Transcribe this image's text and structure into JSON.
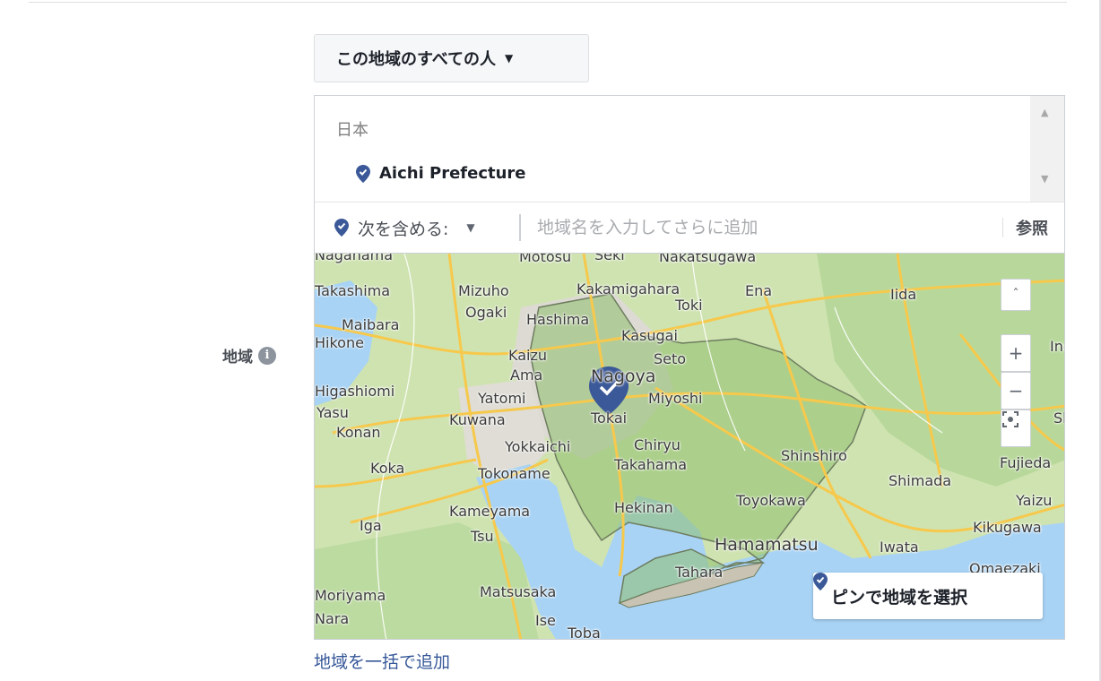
{
  "audience_dropdown": {
    "label": "この地域のすべての人"
  },
  "field_label": "地域",
  "info_icon": "i",
  "selected": {
    "country": "日本",
    "locations": [
      {
        "name": "Aichi Prefecture"
      }
    ]
  },
  "include": {
    "label": "次を含める:",
    "placeholder": "地域名を入力してさらに追加",
    "browse": "参照"
  },
  "map": {
    "places": [
      {
        "name": "Nagahama"
      },
      {
        "name": "Motosu"
      },
      {
        "name": "Seki"
      },
      {
        "name": "Nakatsugawa"
      },
      {
        "name": "Takashima"
      },
      {
        "name": "Mizuho"
      },
      {
        "name": "Kakamigahara"
      },
      {
        "name": "Ena"
      },
      {
        "name": "Iida"
      },
      {
        "name": "Toki"
      },
      {
        "name": "Ogaki"
      },
      {
        "name": "Hashima"
      },
      {
        "name": "Maibara"
      },
      {
        "name": "Hikone"
      },
      {
        "name": "Kasugai"
      },
      {
        "name": "Kaizu"
      },
      {
        "name": "Seto"
      },
      {
        "name": "Ama"
      },
      {
        "name": "Nagoya"
      },
      {
        "name": "Higashiomi"
      },
      {
        "name": "Yatomi"
      },
      {
        "name": "Miyoshi"
      },
      {
        "name": "Yasu"
      },
      {
        "name": "Kuwana"
      },
      {
        "name": "Tokai"
      },
      {
        "name": "Konan"
      },
      {
        "name": "Yokkaichi"
      },
      {
        "name": "Chiryu"
      },
      {
        "name": "Koka"
      },
      {
        "name": "Tokoname"
      },
      {
        "name": "Takahama"
      },
      {
        "name": "Shinshiro"
      },
      {
        "name": "Fujieda"
      },
      {
        "name": "Shimada"
      },
      {
        "name": "Toyokawa"
      },
      {
        "name": "Yaizu"
      },
      {
        "name": "Kameyama"
      },
      {
        "name": "Hekinan"
      },
      {
        "name": "Iga"
      },
      {
        "name": "Tsu"
      },
      {
        "name": "Kikugawa"
      },
      {
        "name": "Hamamatsu"
      },
      {
        "name": "Iwata"
      },
      {
        "name": "Tahara"
      },
      {
        "name": "Omaezaki"
      },
      {
        "name": "Matsusaka"
      },
      {
        "name": "Moriyama"
      },
      {
        "name": "Ise"
      },
      {
        "name": "Toba"
      },
      {
        "name": "Nara"
      },
      {
        "name": "Shizuoka"
      },
      {
        "name": "Ino"
      }
    ],
    "controls": {
      "collapse": "ˆ",
      "zoom_in": "+",
      "zoom_out": "−"
    },
    "pin_select_label": "ピンで地域を選択"
  },
  "bulk_add_link": "地域を一括で追加",
  "colors": {
    "pin": "#3b5998",
    "link": "#365899",
    "highlight": "#8fbf6b",
    "water": "#a8d3f5",
    "road": "#f6c94c"
  }
}
